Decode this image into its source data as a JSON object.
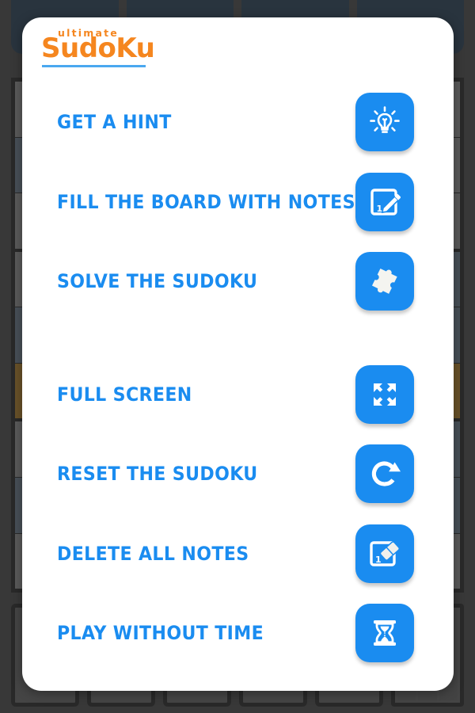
{
  "app": {
    "logo_small": "ultimate",
    "logo_main": "SudoKu",
    "brand_orange": "#f5861f",
    "brand_blue": "#1a8cf0",
    "logo_rule_color": "#4aa8f0"
  },
  "modal": {
    "background": "#ffffff",
    "overlay_color": "rgba(60,60,60,0.62)"
  },
  "menu": {
    "items": [
      {
        "label": "GET A HINT",
        "icon": "lightbulb-icon"
      },
      {
        "label": "FILL THE BOARD WITH NOTES",
        "icon": "note-pencil-icon"
      },
      {
        "label": "SOLVE THE SUDOKU",
        "icon": "puzzle-piece-icon"
      },
      {
        "label": "FULL SCREEN",
        "icon": "fullscreen-arrows-icon"
      },
      {
        "label": "RESET THE SUDOKU",
        "icon": "refresh-circle-icon"
      },
      {
        "label": "DELETE ALL NOTES",
        "icon": "note-eraser-icon"
      },
      {
        "label": "PLAY WITHOUT TIME",
        "icon": "hourglass-icon"
      }
    ]
  },
  "background_board": {
    "top_tab_count": 4,
    "top_tab_color": "#0d2943",
    "grid_rows": 9,
    "grid_cols": 9,
    "cell_default_color": "#8d8d8d",
    "cell_alt_color": "#5d7186",
    "cell_highlight_color": "#b4780d",
    "numpad_key_count": 6
  }
}
